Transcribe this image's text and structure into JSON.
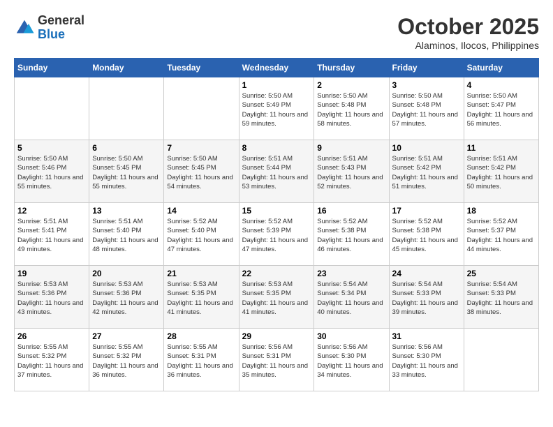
{
  "logo": {
    "general": "General",
    "blue": "Blue"
  },
  "header": {
    "month": "October 2025",
    "location": "Alaminos, Ilocos, Philippines"
  },
  "weekdays": [
    "Sunday",
    "Monday",
    "Tuesday",
    "Wednesday",
    "Thursday",
    "Friday",
    "Saturday"
  ],
  "weeks": [
    [
      {
        "day": "",
        "info": ""
      },
      {
        "day": "",
        "info": ""
      },
      {
        "day": "",
        "info": ""
      },
      {
        "day": "1",
        "info": "Sunrise: 5:50 AM\nSunset: 5:49 PM\nDaylight: 11 hours and 59 minutes."
      },
      {
        "day": "2",
        "info": "Sunrise: 5:50 AM\nSunset: 5:48 PM\nDaylight: 11 hours and 58 minutes."
      },
      {
        "day": "3",
        "info": "Sunrise: 5:50 AM\nSunset: 5:48 PM\nDaylight: 11 hours and 57 minutes."
      },
      {
        "day": "4",
        "info": "Sunrise: 5:50 AM\nSunset: 5:47 PM\nDaylight: 11 hours and 56 minutes."
      }
    ],
    [
      {
        "day": "5",
        "info": "Sunrise: 5:50 AM\nSunset: 5:46 PM\nDaylight: 11 hours and 55 minutes."
      },
      {
        "day": "6",
        "info": "Sunrise: 5:50 AM\nSunset: 5:45 PM\nDaylight: 11 hours and 55 minutes."
      },
      {
        "day": "7",
        "info": "Sunrise: 5:50 AM\nSunset: 5:45 PM\nDaylight: 11 hours and 54 minutes."
      },
      {
        "day": "8",
        "info": "Sunrise: 5:51 AM\nSunset: 5:44 PM\nDaylight: 11 hours and 53 minutes."
      },
      {
        "day": "9",
        "info": "Sunrise: 5:51 AM\nSunset: 5:43 PM\nDaylight: 11 hours and 52 minutes."
      },
      {
        "day": "10",
        "info": "Sunrise: 5:51 AM\nSunset: 5:42 PM\nDaylight: 11 hours and 51 minutes."
      },
      {
        "day": "11",
        "info": "Sunrise: 5:51 AM\nSunset: 5:42 PM\nDaylight: 11 hours and 50 minutes."
      }
    ],
    [
      {
        "day": "12",
        "info": "Sunrise: 5:51 AM\nSunset: 5:41 PM\nDaylight: 11 hours and 49 minutes."
      },
      {
        "day": "13",
        "info": "Sunrise: 5:51 AM\nSunset: 5:40 PM\nDaylight: 11 hours and 48 minutes."
      },
      {
        "day": "14",
        "info": "Sunrise: 5:52 AM\nSunset: 5:40 PM\nDaylight: 11 hours and 47 minutes."
      },
      {
        "day": "15",
        "info": "Sunrise: 5:52 AM\nSunset: 5:39 PM\nDaylight: 11 hours and 47 minutes."
      },
      {
        "day": "16",
        "info": "Sunrise: 5:52 AM\nSunset: 5:38 PM\nDaylight: 11 hours and 46 minutes."
      },
      {
        "day": "17",
        "info": "Sunrise: 5:52 AM\nSunset: 5:38 PM\nDaylight: 11 hours and 45 minutes."
      },
      {
        "day": "18",
        "info": "Sunrise: 5:52 AM\nSunset: 5:37 PM\nDaylight: 11 hours and 44 minutes."
      }
    ],
    [
      {
        "day": "19",
        "info": "Sunrise: 5:53 AM\nSunset: 5:36 PM\nDaylight: 11 hours and 43 minutes."
      },
      {
        "day": "20",
        "info": "Sunrise: 5:53 AM\nSunset: 5:36 PM\nDaylight: 11 hours and 42 minutes."
      },
      {
        "day": "21",
        "info": "Sunrise: 5:53 AM\nSunset: 5:35 PM\nDaylight: 11 hours and 41 minutes."
      },
      {
        "day": "22",
        "info": "Sunrise: 5:53 AM\nSunset: 5:35 PM\nDaylight: 11 hours and 41 minutes."
      },
      {
        "day": "23",
        "info": "Sunrise: 5:54 AM\nSunset: 5:34 PM\nDaylight: 11 hours and 40 minutes."
      },
      {
        "day": "24",
        "info": "Sunrise: 5:54 AM\nSunset: 5:33 PM\nDaylight: 11 hours and 39 minutes."
      },
      {
        "day": "25",
        "info": "Sunrise: 5:54 AM\nSunset: 5:33 PM\nDaylight: 11 hours and 38 minutes."
      }
    ],
    [
      {
        "day": "26",
        "info": "Sunrise: 5:55 AM\nSunset: 5:32 PM\nDaylight: 11 hours and 37 minutes."
      },
      {
        "day": "27",
        "info": "Sunrise: 5:55 AM\nSunset: 5:32 PM\nDaylight: 11 hours and 36 minutes."
      },
      {
        "day": "28",
        "info": "Sunrise: 5:55 AM\nSunset: 5:31 PM\nDaylight: 11 hours and 36 minutes."
      },
      {
        "day": "29",
        "info": "Sunrise: 5:56 AM\nSunset: 5:31 PM\nDaylight: 11 hours and 35 minutes."
      },
      {
        "day": "30",
        "info": "Sunrise: 5:56 AM\nSunset: 5:30 PM\nDaylight: 11 hours and 34 minutes."
      },
      {
        "day": "31",
        "info": "Sunrise: 5:56 AM\nSunset: 5:30 PM\nDaylight: 11 hours and 33 minutes."
      },
      {
        "day": "",
        "info": ""
      }
    ]
  ]
}
